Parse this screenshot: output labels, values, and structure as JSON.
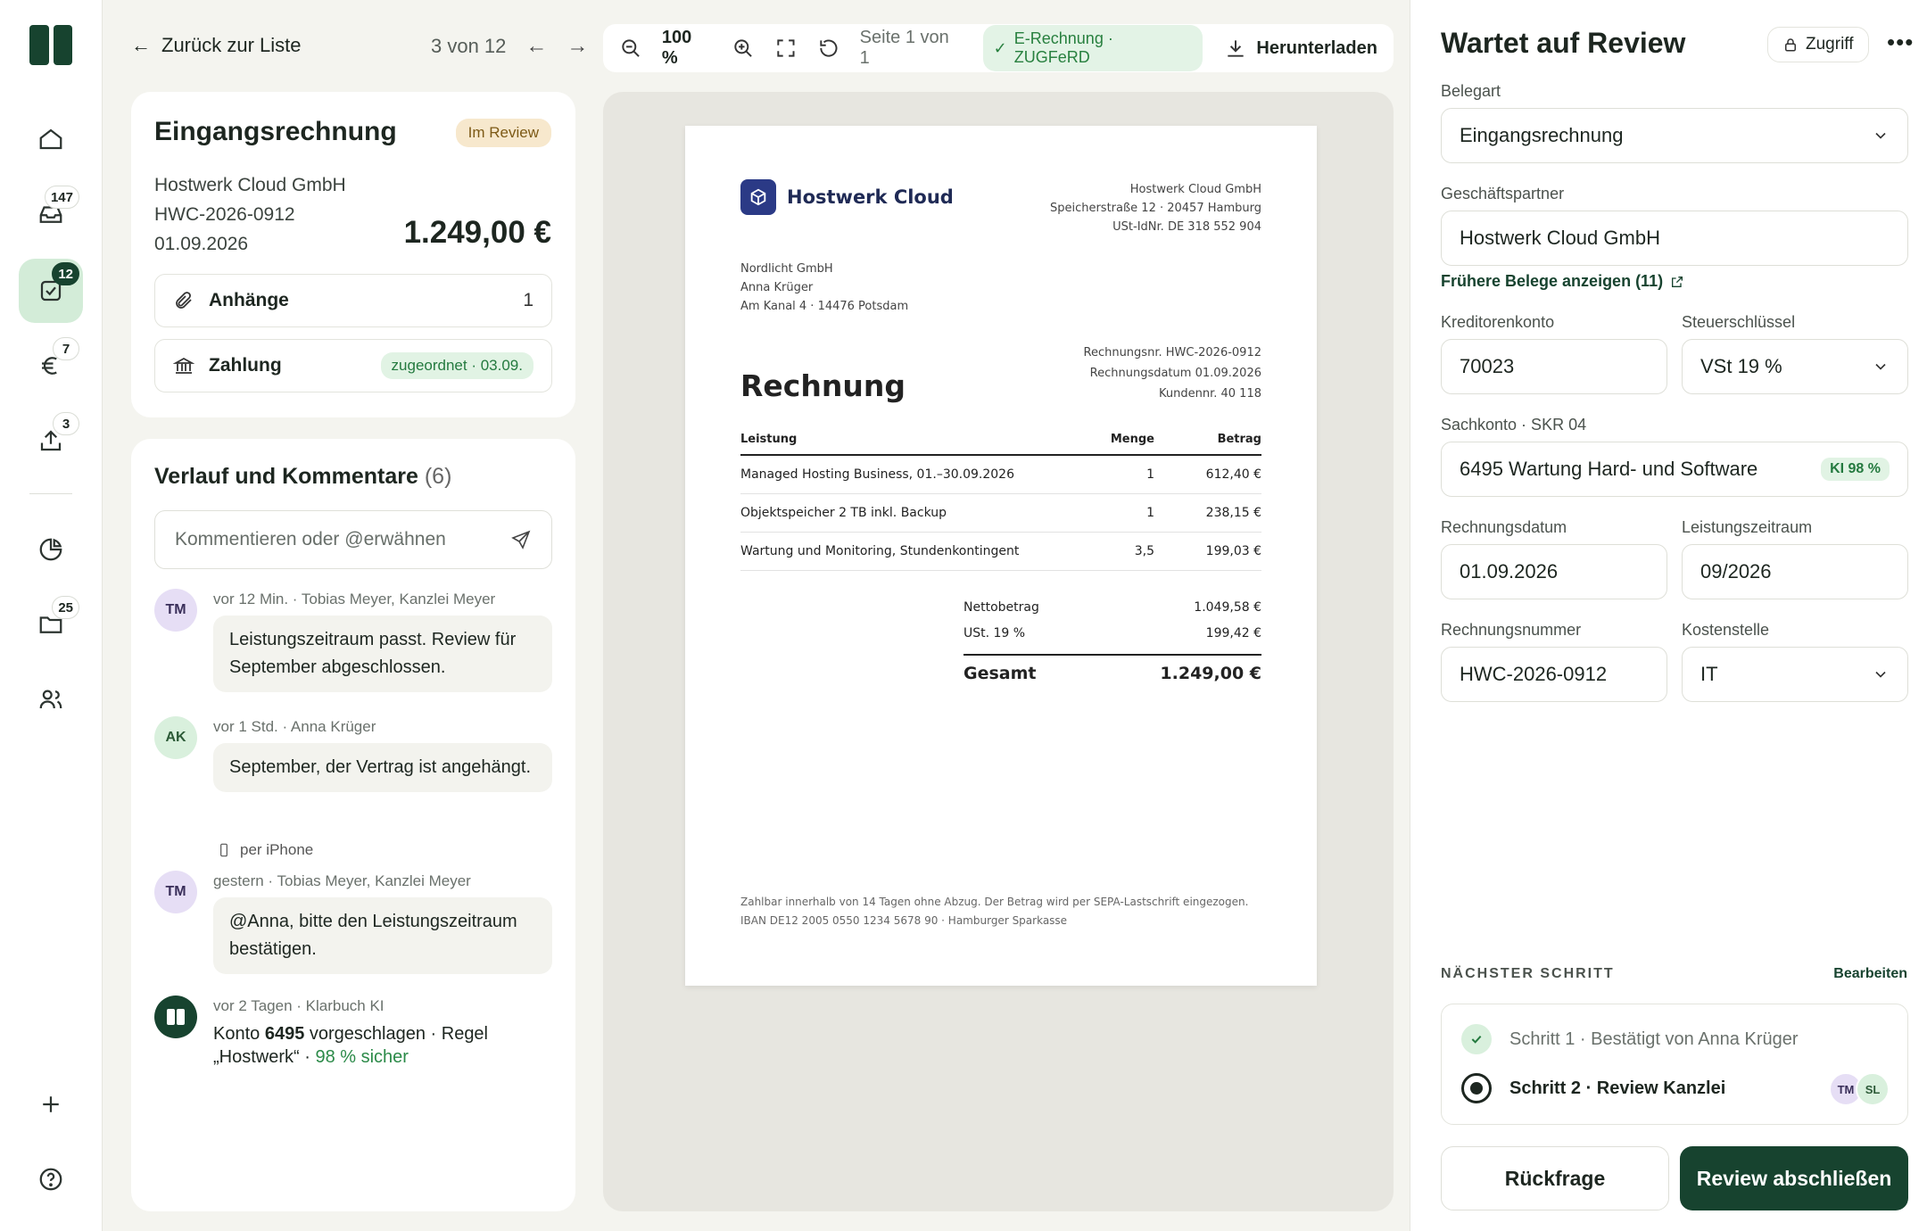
{
  "rail": {
    "badges": {
      "inbox": "147",
      "review": "12",
      "payments": "7",
      "export": "3",
      "documents": "25"
    }
  },
  "nav": {
    "back_label": "Zurück zur Liste",
    "pager": "3 von 12"
  },
  "invoice": {
    "title": "Eingangsrechnung",
    "status": "Im Review",
    "partner": "Hostwerk Cloud GmbH",
    "number": "HWC-2026-0912",
    "date": "01.09.2026",
    "amount": "1.249,00 €",
    "attachments_label": "Anhänge",
    "attachments_count": "1",
    "payment_label": "Zahlung",
    "payment_status": "zugeordnet · 03.09."
  },
  "history": {
    "title": "Verlauf und Kommentare",
    "count": "(6)",
    "input_placeholder": "Kommentieren oder @erwähnen",
    "items": [
      {
        "initials": "TM",
        "meta": "vor 12 Min. · Tobias Meyer, Kanzlei Meyer",
        "text": "Leistungszeitraum passt. Review für September abgeschlossen."
      },
      {
        "initials": "AK",
        "meta": "vor 1 Std. · Anna Krüger",
        "text": "September, der Vertrag ist angehängt.",
        "sub": "per iPhone"
      },
      {
        "initials": "TM",
        "meta": "gestern · Tobias Meyer, Kanzlei Meyer",
        "text": "@Anna, bitte den Leistungszeitraum bestätigen."
      },
      {
        "meta": "vor 2 Tagen · Klarbuch KI",
        "text_a": "Konto ",
        "account": "6495",
        "text_b": " vorgeschlagen · Regel „Hostwerk“ · ",
        "confidence": "98 % sicher"
      }
    ]
  },
  "viewer": {
    "zoom": "100 %",
    "page": "Seite 1 von 1",
    "einvoice": "E-Rechnung · ZUGFeRD",
    "download": "Herunterladen"
  },
  "document": {
    "brand": "Hostwerk Cloud",
    "sender_lines": [
      "Hostwerk Cloud GmbH",
      "Speicherstraße 12 · 20457 Hamburg",
      "USt-IdNr. DE 318 552 904"
    ],
    "recipient_lines": [
      "Nordlicht GmbH",
      "Anna Krüger",
      "Am Kanal 4 · 14476 Potsdam"
    ],
    "ref_lines": [
      "Rechnungsnr. HWC-2026-0912",
      "Rechnungsdatum 01.09.2026",
      "Kundennr. 40 118"
    ],
    "heading": "Rechnung",
    "columns": {
      "item": "Leistung",
      "qty": "Menge",
      "amount": "Betrag"
    },
    "rows": [
      {
        "item": "Managed Hosting Business, 01.–30.09.2026",
        "qty": "1",
        "amount": "612,40 €"
      },
      {
        "item": "Objektspeicher 2 TB inkl. Backup",
        "qty": "1",
        "amount": "238,15 €"
      },
      {
        "item": "Wartung und Monitoring, Stundenkontingent",
        "qty": "3,5",
        "amount": "199,03 €"
      }
    ],
    "net_label": "Nettobetrag",
    "net": "1.049,58 €",
    "vat_label": "USt. 19 %",
    "vat": "199,42 €",
    "total_label": "Gesamt",
    "total": "1.249,00 €",
    "footer_1": "Zahlbar innerhalb von 14 Tagen ohne Abzug. Der Betrag wird per SEPA-Lastschrift eingezogen.",
    "footer_2": "IBAN DE12 2005 0550 1234 5678 90 · Hamburger Sparkasse"
  },
  "panel": {
    "title": "Wartet auf Review",
    "access": "Zugriff",
    "doc_type_label": "Belegart",
    "doc_type": "Eingangsrechnung",
    "partner_label": "Geschäftspartner",
    "partner": "Hostwerk Cloud GmbH",
    "prev_docs": "Frühere Belege anzeigen (11)",
    "creditor_label": "Kreditorenkonto",
    "creditor": "70023",
    "tax_label": "Steuerschlüssel",
    "tax": "VSt 19 %",
    "ledger_label": "Sachkonto · SKR 04",
    "ledger": "6495 Wartung Hard- und Software",
    "ledger_ai": "KI 98 %",
    "inv_date_label": "Rechnungsdatum",
    "inv_date": "01.09.2026",
    "period_label": "Leistungszeitraum",
    "period": "09/2026",
    "inv_no_label": "Rechnungsnummer",
    "inv_no": "HWC-2026-0912",
    "cost_label": "Kostenstelle",
    "cost": "IT",
    "next_step_label": "NÄCHSTER SCHRITT",
    "edit": "Bearbeiten",
    "step1": "Schritt 1 · Bestätigt von Anna Krüger",
    "step2": "Schritt 2 · Review Kanzlei",
    "step2_assignees": [
      "TM",
      "SL"
    ],
    "query_btn": "Rückfrage",
    "complete_btn": "Review abschließen"
  },
  "colors": {
    "brand": "#17432f",
    "accent_green": "#247a3f",
    "review_badge": "#f7e8cd"
  }
}
